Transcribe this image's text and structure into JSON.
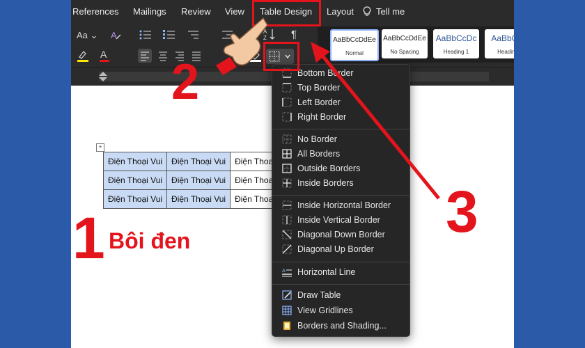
{
  "menubar": {
    "items": [
      "References",
      "Mailings",
      "Review",
      "View",
      "Table Design",
      "Layout",
      "Tell me"
    ],
    "active": "Table Design",
    "tell_me_icon": "lightbulb-icon"
  },
  "ribbon": {
    "font_size_label": "Aa",
    "pilcrow": "¶"
  },
  "styles": [
    {
      "sample": "AaBbCcDdEe",
      "name": "Normal"
    },
    {
      "sample": "AaBbCcDdEe",
      "name": "No Spacing"
    },
    {
      "sample": "AaBbCcDc",
      "name": "Heading 1"
    },
    {
      "sample": "AaBbCcI",
      "name": "Heading"
    }
  ],
  "table": {
    "rows": [
      [
        "Điện Thoại Vui",
        "Điện Thoại Vui",
        "Điện Thoa"
      ],
      [
        "Điện Thoại Vui",
        "Điện Thoại Vui",
        "Điện Thoa"
      ],
      [
        "Điện Thoại Vui",
        "Điện Thoại Vui",
        "Điện Thoa"
      ]
    ]
  },
  "borders_menu": {
    "groups": [
      [
        "Bottom Border",
        "Top Border",
        "Left Border",
        "Right Border"
      ],
      [
        "No Border",
        "All Borders",
        "Outside Borders",
        "Inside Borders"
      ],
      [
        "Inside Horizontal Border",
        "Inside Vertical Border",
        "Diagonal Down Border",
        "Diagonal Up Border"
      ],
      [
        "Horizontal Line"
      ],
      [
        "Draw Table",
        "View Gridlines",
        "Borders and Shading..."
      ]
    ]
  },
  "annotations": {
    "step1_number": "1",
    "step1_label": "Bôi đen",
    "step2_number": "2",
    "step3_number": "3"
  },
  "colors": {
    "accent_red": "#e3141c",
    "background_blue": "#2a5aa8",
    "ribbon_dark": "#2b2b2b",
    "selection": "#c8daf4"
  }
}
